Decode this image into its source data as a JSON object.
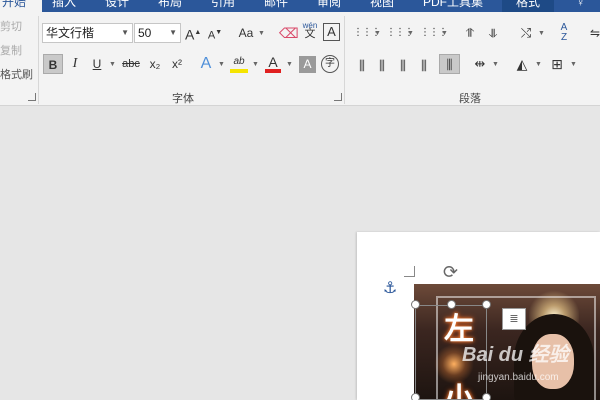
{
  "tabs": [
    {
      "label": "开始",
      "active_left": true
    },
    {
      "label": "插入"
    },
    {
      "label": "设计"
    },
    {
      "label": "布局"
    },
    {
      "label": "引用"
    },
    {
      "label": "邮件"
    },
    {
      "label": "审阅"
    },
    {
      "label": "视图"
    },
    {
      "label": "PDF工具集"
    },
    {
      "label": "格式",
      "active": true
    }
  ],
  "clipboard": {
    "cut": "剪切",
    "copy": "复制",
    "format_painter": "格式刷"
  },
  "font": {
    "name": "华文行楷",
    "size": "50",
    "group_label": "字体",
    "grow": "A",
    "shrink": "A",
    "change_case": "Aa",
    "phonetic": "wén",
    "phonetic_char": "文",
    "border_char": "A",
    "bold": "B",
    "italic": "I",
    "underline": "U",
    "strike": "abc",
    "subscript": "x₂",
    "superscript": "x²",
    "effects": "A",
    "highlight": "ab",
    "font_color": "A",
    "shading_char": "A",
    "enclose_char": "字",
    "highlight_color": "#f5e400",
    "font_color_value": "#e02020"
  },
  "paragraph": {
    "group_label": "段落"
  },
  "document": {
    "vertical_text": [
      "左",
      "小"
    ],
    "watermark": "Bai du 经验",
    "watermark_url": "jingyan.baidu.com"
  }
}
